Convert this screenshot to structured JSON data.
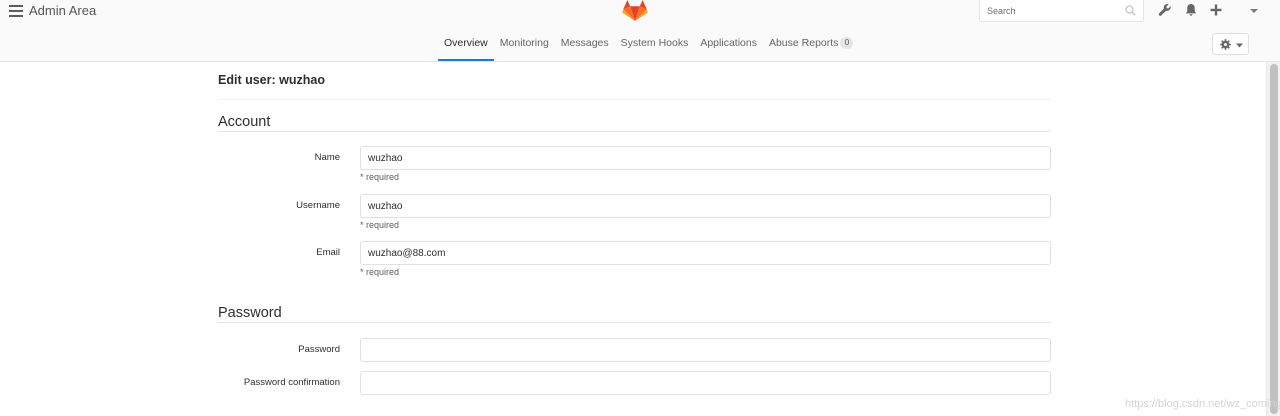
{
  "header": {
    "title": "Admin Area",
    "search": {
      "placeholder": "Search",
      "value": ""
    },
    "icons": [
      "wrench-icon",
      "bell-icon",
      "plus-icon",
      "caret-down-icon"
    ],
    "colors": {
      "accent": "#1f78d1",
      "logo_orange": "#fc6d26",
      "logo_red": "#e24329",
      "logo_light": "#fca326"
    }
  },
  "nav": {
    "tabs": [
      {
        "label": "Overview",
        "active": true
      },
      {
        "label": "Monitoring"
      },
      {
        "label": "Messages"
      },
      {
        "label": "System Hooks"
      },
      {
        "label": "Applications"
      },
      {
        "label": "Abuse Reports",
        "badge": "0"
      }
    ]
  },
  "page": {
    "title": "Edit user: wuzhao"
  },
  "account": {
    "heading": "Account",
    "fields": [
      {
        "label": "Name",
        "value": "wuzhao",
        "help": "* required"
      },
      {
        "label": "Username",
        "value": "wuzhao",
        "help": "* required"
      },
      {
        "label": "Email",
        "value": "wuzhao@88.com",
        "help": "* required"
      }
    ]
  },
  "password": {
    "heading": "Password",
    "fields": [
      {
        "label": "Password",
        "value": ""
      },
      {
        "label": "Password confirmation",
        "value": ""
      }
    ]
  },
  "watermark": "https://blog.csdn.net/wz_coming"
}
